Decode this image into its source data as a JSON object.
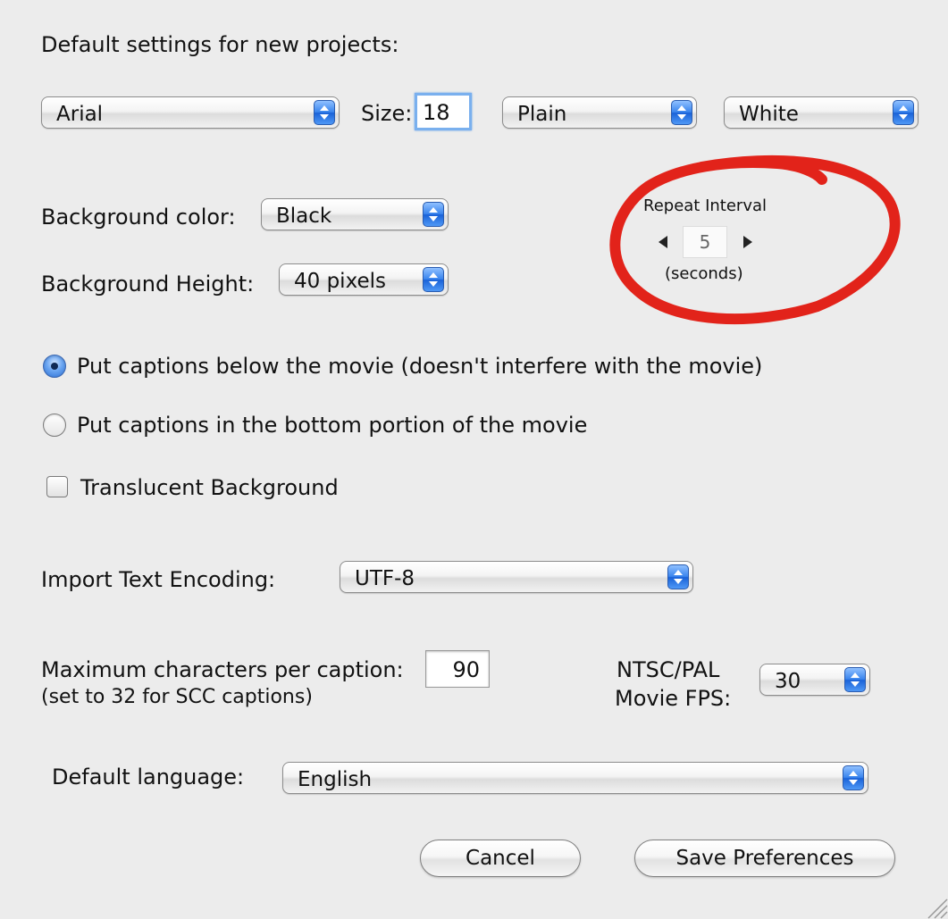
{
  "heading": "Default settings for new projects:",
  "font": {
    "family_value": "Arial",
    "size_label": "Size:",
    "size_value": "18",
    "style_value": "Plain",
    "color_value": "White"
  },
  "background": {
    "color_label": "Background color:",
    "color_value": "Black",
    "height_label": "Background Height:",
    "height_value": "40 pixels"
  },
  "repeat": {
    "title": "Repeat Interval",
    "value": "5",
    "unit": "(seconds)"
  },
  "placement": {
    "option_below": "Put captions below the movie (doesn't interfere with the movie)",
    "option_bottom": "Put captions in the bottom portion of the movie",
    "selected": "below"
  },
  "translucent_label": "Translucent Background",
  "encoding": {
    "label": "Import Text Encoding:",
    "value": "UTF-8"
  },
  "max_chars": {
    "label_line1": "Maximum characters per caption:",
    "label_line2": "(set to 32 for SCC captions)",
    "value": "90"
  },
  "fps": {
    "label_line1": "NTSC/PAL",
    "label_line2": "Movie FPS:",
    "value": "30"
  },
  "language": {
    "label": "Default language:",
    "value": "English"
  },
  "buttons": {
    "cancel": "Cancel",
    "save": "Save Preferences"
  },
  "colors": {
    "dialog_bg": "#ececec",
    "annotation": "#e2231a",
    "popup_arrow_blue": "#3a85ee"
  }
}
